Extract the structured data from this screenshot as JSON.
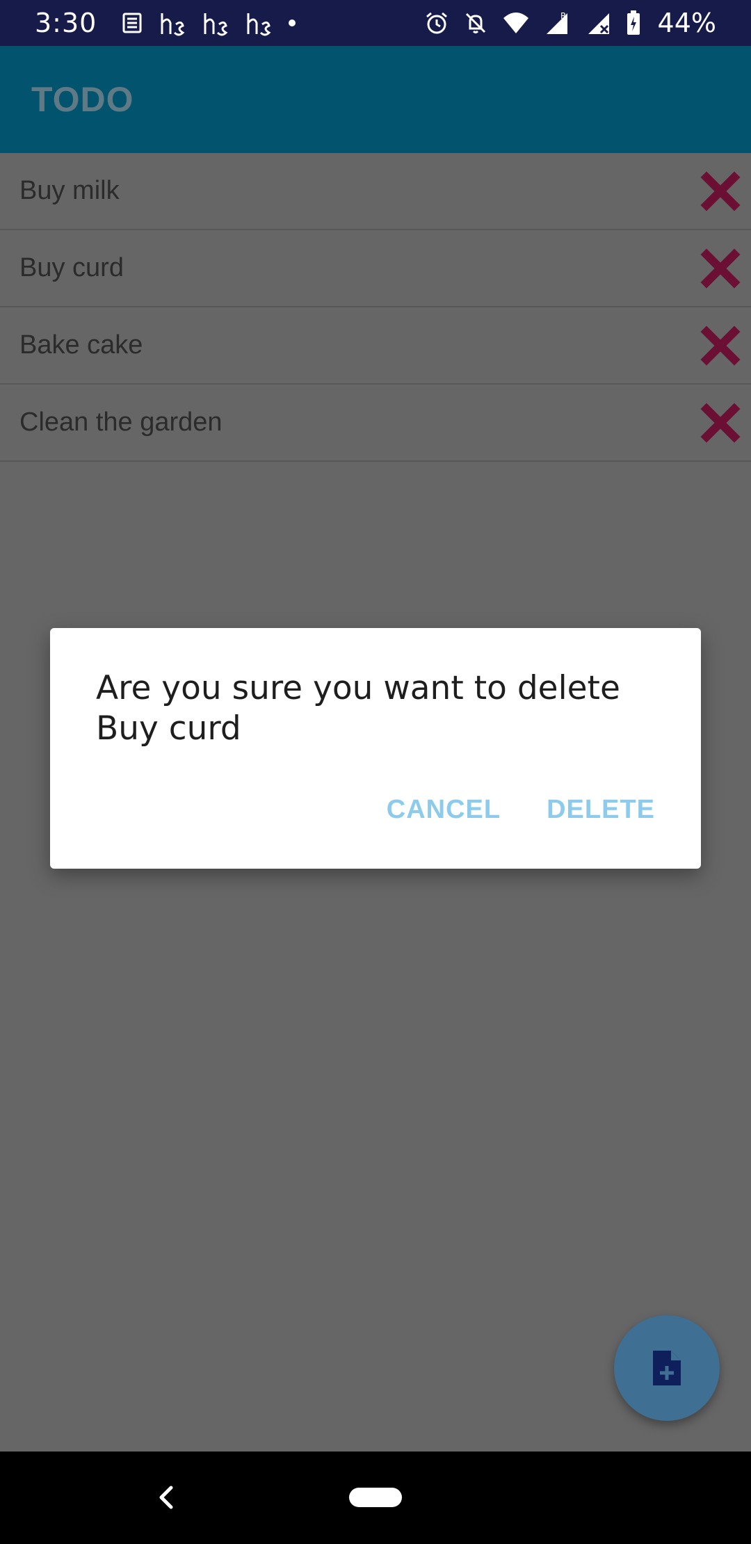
{
  "status_bar": {
    "time": "3:30",
    "battery": "44%",
    "icons": [
      "news-icon",
      "hs-icon",
      "hs-icon",
      "hs-icon",
      "dot-icon",
      "alarm-icon",
      "bell-off-icon",
      "wifi-icon",
      "signal-r-icon",
      "signal-x-icon",
      "battery-charging-icon"
    ]
  },
  "appbar": {
    "title": "TODO"
  },
  "todos": [
    {
      "label": "Buy milk"
    },
    {
      "label": "Buy curd"
    },
    {
      "label": "Bake cake"
    },
    {
      "label": "Clean the garden"
    }
  ],
  "dialog": {
    "message": "Are you sure you want to delete Buy curd",
    "cancel_label": "CANCEL",
    "delete_label": "DELETE"
  },
  "fab": {
    "icon": "add-note-icon"
  },
  "colors": {
    "status_bar": "#171b4a",
    "appbar": "#02536e",
    "scrim_background": "#666666",
    "delete_icon": "#6b0f35",
    "dialog_button": "#8ccbec",
    "fab": "#3f6f92"
  }
}
